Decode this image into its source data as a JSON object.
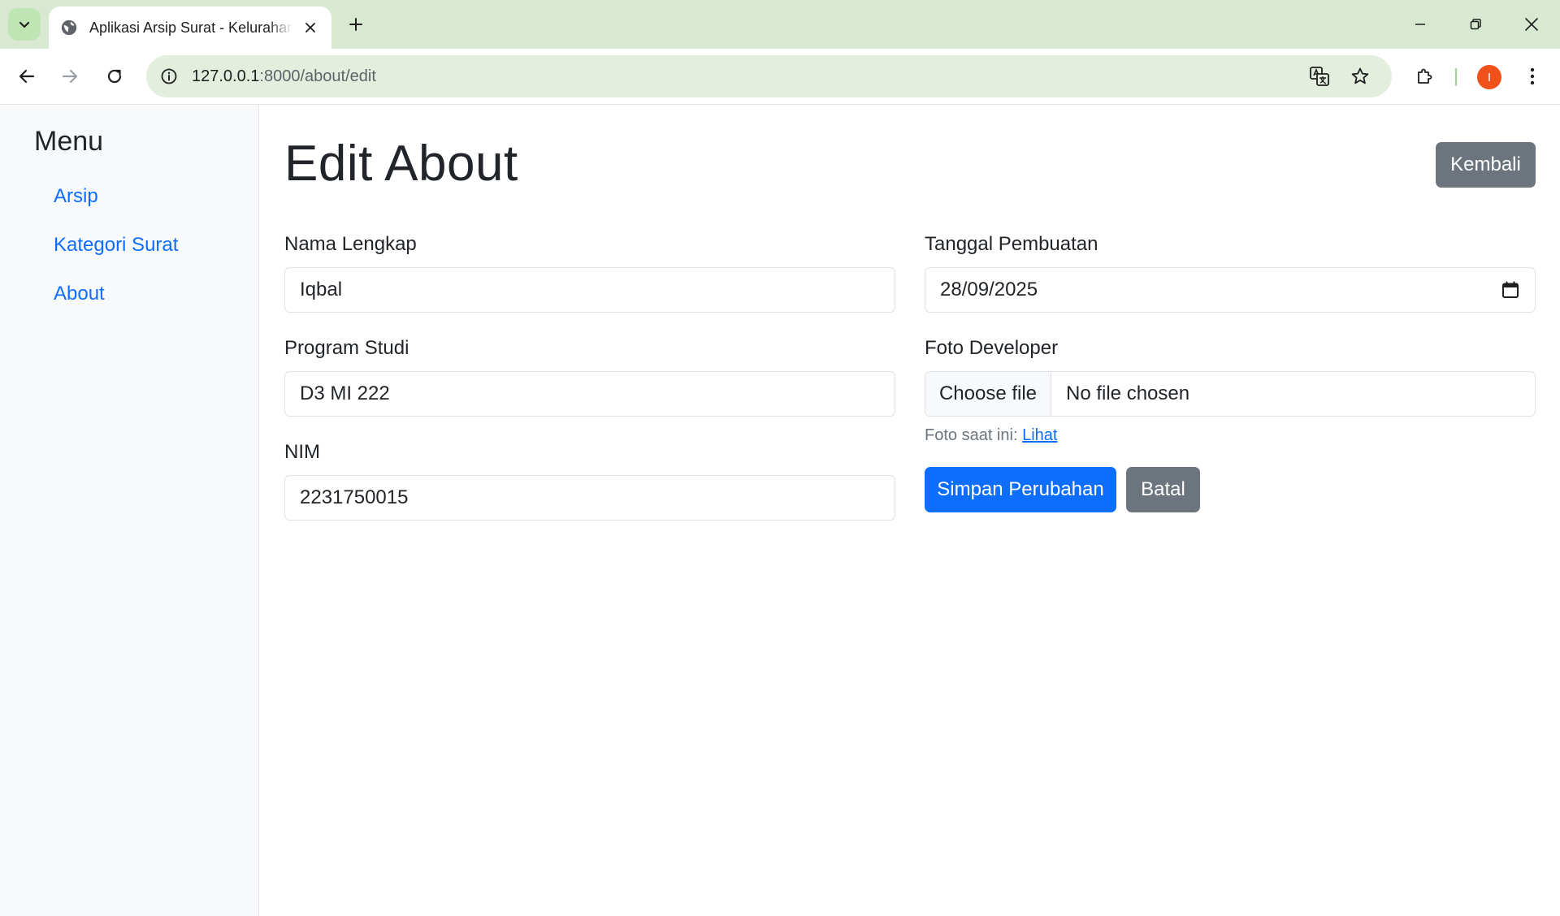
{
  "browser": {
    "tab_title": "Aplikasi Arsip Surat - Kelurahan",
    "url_host": "127.0.0.1",
    "url_rest": ":8000/about/edit",
    "avatar_letter": "I",
    "colors": {
      "tabstrip": "#d9e8d0",
      "omnibox": "#e4eedf",
      "avatar": "#f0501a"
    }
  },
  "sidebar": {
    "title": "Menu",
    "items": [
      {
        "label": "Arsip"
      },
      {
        "label": "Kategori Surat"
      },
      {
        "label": "About"
      }
    ]
  },
  "page": {
    "title": "Edit About",
    "back_button": "Kembali"
  },
  "form": {
    "nama": {
      "label": "Nama Lengkap",
      "value": "Iqbal"
    },
    "prodi": {
      "label": "Program Studi",
      "value": "D3 MI 222"
    },
    "nim": {
      "label": "NIM",
      "value": "2231750015"
    },
    "tanggal": {
      "label": "Tanggal Pembuatan",
      "value": "28/09/2025"
    },
    "foto": {
      "label": "Foto Developer",
      "choose_label": "Choose file",
      "status": "No file chosen",
      "help_prefix": "Foto saat ini:",
      "help_link": "Lihat"
    },
    "save_button": "Simpan Perubahan",
    "cancel_button": "Batal"
  },
  "colors": {
    "primary": "#0d6efd",
    "secondary": "#6c757d",
    "sidebar_bg": "#f8f9fa"
  }
}
